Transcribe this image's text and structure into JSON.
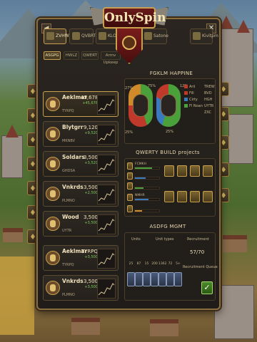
{
  "app": {
    "title": "OnlySpin"
  },
  "nav": {
    "back": "◀",
    "close": "✕"
  },
  "top_tabs": [
    {
      "label": "ZVHW",
      "active": true
    },
    {
      "label": "QVBRT",
      "active": false
    },
    {
      "label": "KLOP",
      "active": false
    },
    {
      "label": "Satone",
      "active": false
    },
    {
      "label": "Kivitpm",
      "active": false
    }
  ],
  "sub_tabs": [
    {
      "label": "ASGPG",
      "active": true
    },
    {
      "label": "HWLZ",
      "active": false
    },
    {
      "label": "QWERT",
      "active": false
    },
    {
      "label": "Armv Upkeep",
      "active": false
    }
  ],
  "resources": [
    {
      "name": "Aeklmar",
      "sub": "TYRPQ",
      "value": "45,678",
      "delta": "+45,678",
      "highlight": true
    },
    {
      "name": "Blytgrr",
      "sub": "MKNBV",
      "value": "9,120",
      "delta": "+9,520",
      "highlight": false
    },
    {
      "name": "Soldars",
      "sub": "GHDSA",
      "value": "3,500",
      "delta": "+3,520",
      "highlight": false
    },
    {
      "name": "Vnkrds",
      "sub": "PLMNO",
      "value": "3,500",
      "delta": "+2,500",
      "highlight": false
    },
    {
      "name": "Wood",
      "sub": "UYTR",
      "value": "3,500",
      "delta": "+3,500",
      "highlight": false
    },
    {
      "name": "Aeklmar",
      "sub": "TYRPQ",
      "value": "TYRPQ",
      "delta": "+3,500",
      "highlight": false
    },
    {
      "name": "Vnkrds",
      "sub": "PLMNO",
      "value": "3,500",
      "delta": "+3,500",
      "highlight": false
    }
  ],
  "happiness": {
    "title": "FGKLM HAPPINE",
    "left_pct_top": "27%",
    "left_pct_side": "75%",
    "left_pct_bottom": "25%",
    "right_pct": "25%",
    "right_pct_side": "12%",
    "legend": [
      "Arii",
      "Fill",
      "Cirty",
      "Fl Noan"
    ],
    "legend_right": [
      "TREW",
      "BVD",
      "HGH",
      "UYTR",
      "ZXC"
    ],
    "colors": {
      "green": "#4aa03a",
      "red": "#c0392b",
      "blue": "#3a7ac0",
      "orange": "#d08a2a"
    }
  },
  "build": {
    "title": "QWERTY BUILD projects",
    "rows": [
      {
        "label": "FCMKH",
        "progress": 0.7,
        "color": "#4aa03a"
      },
      {
        "label": "",
        "progress": 0.45,
        "color": "#3a7ac0"
      },
      {
        "label": "",
        "progress": 0.35,
        "color": "#4aa03a"
      },
      {
        "label": "NMHR",
        "progress": 0.55,
        "color": "#3a7ac0"
      },
      {
        "label": "",
        "progress": 0.3,
        "color": "#d08a2a"
      }
    ]
  },
  "military": {
    "title": "ASDFG MGMT",
    "units_label": "Units",
    "unit_types_label": "Unit types",
    "recruitment_label": "Recruitment",
    "recruit_count": "57/70",
    "queue_label": "Recruitment Queue",
    "unit_counts": [
      "25",
      "87",
      "15",
      "200",
      "1362",
      "72",
      "5+"
    ],
    "confirm": "✓"
  }
}
